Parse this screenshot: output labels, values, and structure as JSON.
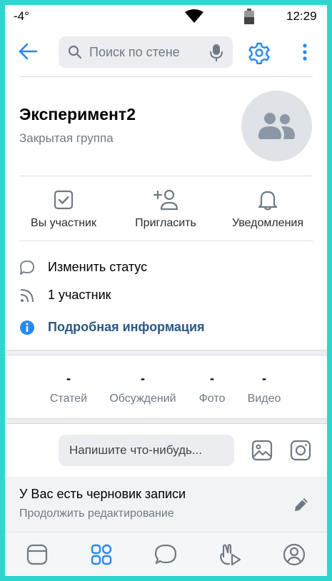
{
  "status_bar": {
    "temperature": "-4°",
    "time": "12:29"
  },
  "header": {
    "search_placeholder": "Поиск по стене"
  },
  "group": {
    "name": "Эксперимент2",
    "type": "Закрытая группа"
  },
  "actions": [
    {
      "label": "Вы участник",
      "icon": "checkbox-checked-icon"
    },
    {
      "label": "Пригласить",
      "icon": "add-person-icon"
    },
    {
      "label": "Уведомления",
      "icon": "bell-icon"
    }
  ],
  "info": {
    "status": "Изменить статус",
    "members": "1 участник",
    "details": "Подробная информация"
  },
  "counters": [
    {
      "value": "-",
      "label": "Статей"
    },
    {
      "value": "-",
      "label": "Обсуждений"
    },
    {
      "value": "-",
      "label": "Фото"
    },
    {
      "value": "-",
      "label": "Видео"
    }
  ],
  "composer": {
    "placeholder": "Напишите что-нибудь..."
  },
  "draft": {
    "title": "У Вас есть черновик записи",
    "subtitle": "Продолжить редактирование"
  },
  "navbar": {
    "items": [
      "news-icon",
      "services-icon",
      "messages-icon",
      "clips-icon",
      "profile-icon"
    ]
  },
  "colors": {
    "accent": "#2787f5",
    "link": "#2a5885",
    "frame": "#2ed6cf",
    "info_icon": "#2787f5"
  }
}
